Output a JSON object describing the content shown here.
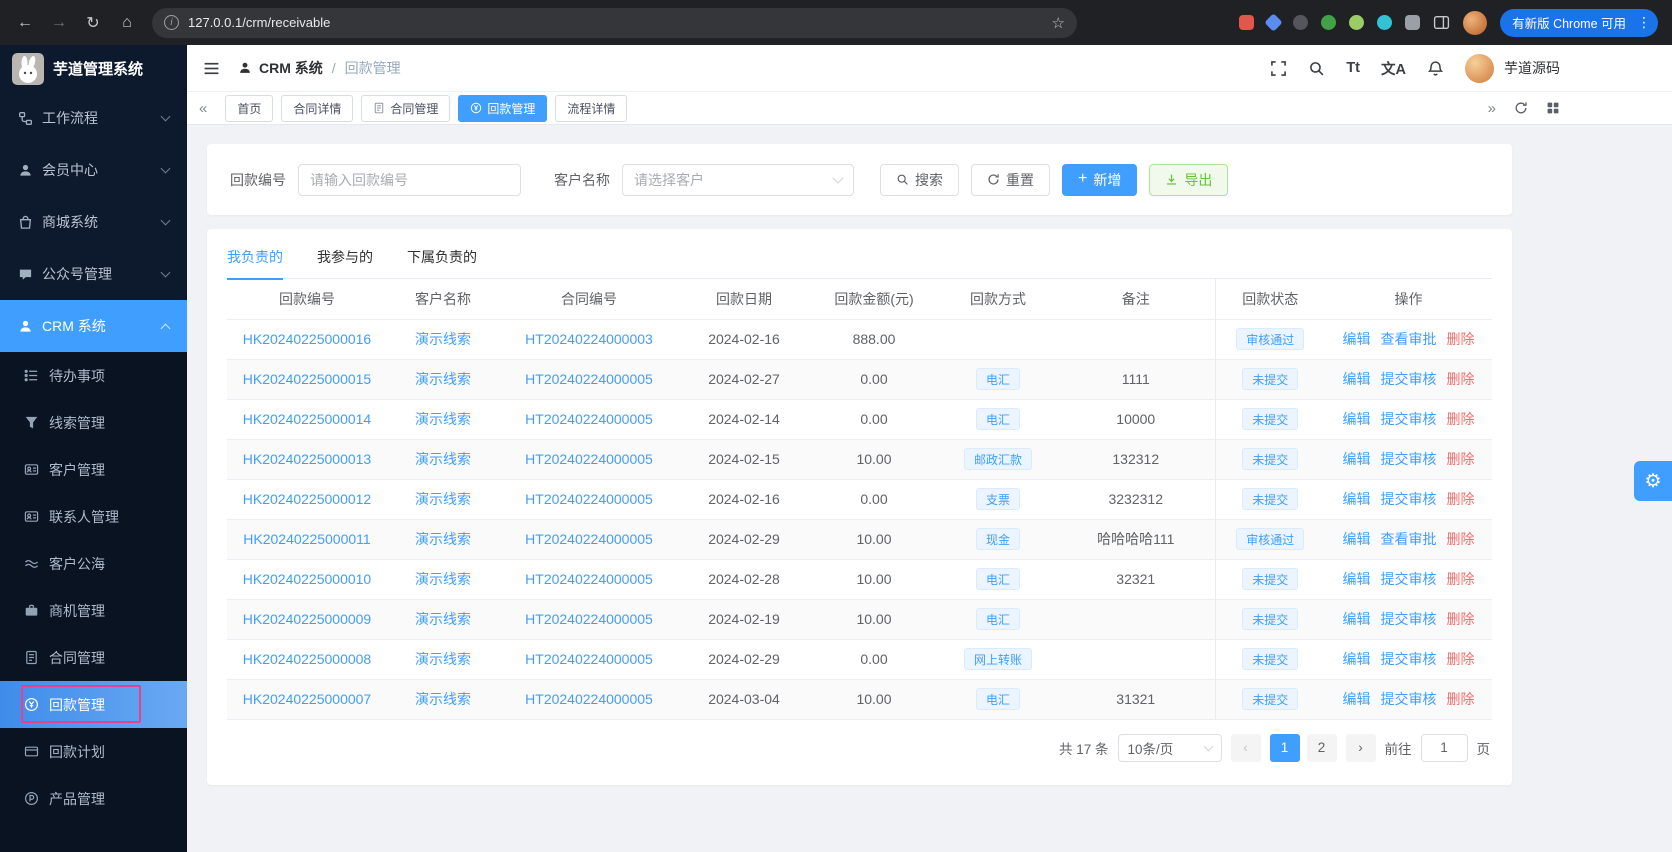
{
  "colors": {
    "primary": "#409eff",
    "danger": "#f56c6c",
    "success": "#67c23a",
    "highlight": "#ea3e8e",
    "chrome_update": "#1a73e8"
  },
  "glyphs": {
    "back": "←",
    "forward": "→",
    "reload": "↻",
    "home": "⌂",
    "star": "☆",
    "info": "i",
    "dots": "⋮",
    "guillemet_left": "«",
    "guillemet_right": "»",
    "prev": "‹",
    "next": "›",
    "plus": "+",
    "gear": "⚙",
    "font_size": "Tt",
    "translate": "文A"
  },
  "browser": {
    "url": "127.0.0.1/crm/receivable",
    "update_button": "有新版 Chrome 可用",
    "extensions": [
      {
        "name": "extension-icon-red",
        "color": "#e2574c",
        "shape": "square"
      },
      {
        "name": "extension-icon-blue",
        "color": "#5b8def",
        "shape": "diamond"
      },
      {
        "name": "extension-icon-dark",
        "color": "#53575d",
        "shape": "circle"
      },
      {
        "name": "extension-icon-green",
        "color": "#43a047",
        "shape": "circle"
      },
      {
        "name": "extension-icon-lightgreen",
        "color": "#9ccc65",
        "shape": "circle"
      },
      {
        "name": "extension-icon-teal",
        "color": "#31c3d4",
        "shape": "circle"
      },
      {
        "name": "extension-icon-puzzle",
        "color": "#9aa0a6",
        "shape": "square"
      }
    ]
  },
  "app": {
    "logo_title": "芋道管理系统",
    "user_name": "芋道源码"
  },
  "sidebar": {
    "top_items": [
      {
        "key": "workflow",
        "label": "工作流程",
        "icon": "flow",
        "active": false
      },
      {
        "key": "member",
        "label": "会员中心",
        "icon": "person",
        "active": false
      },
      {
        "key": "mall",
        "label": "商城系统",
        "icon": "bag",
        "active": false
      },
      {
        "key": "wechat-mp",
        "label": "公众号管理",
        "icon": "chat",
        "active": false
      },
      {
        "key": "crm",
        "label": "CRM 系统",
        "icon": "person",
        "active": true
      }
    ],
    "sub_items": [
      {
        "key": "todo",
        "label": "待办事项",
        "icon": "list",
        "active": false
      },
      {
        "key": "clue",
        "label": "线索管理",
        "icon": "funnel",
        "active": false
      },
      {
        "key": "customer",
        "label": "客户管理",
        "icon": "idcard",
        "active": false
      },
      {
        "key": "contact",
        "label": "联系人管理",
        "icon": "idcard",
        "active": false
      },
      {
        "key": "public-pool",
        "label": "客户公海",
        "icon": "waves",
        "active": false
      },
      {
        "key": "business",
        "label": "商机管理",
        "icon": "briefcase",
        "active": false
      },
      {
        "key": "contract",
        "label": "合同管理",
        "icon": "doc",
        "active": false
      },
      {
        "key": "receivable",
        "label": "回款管理",
        "icon": "money",
        "active": true,
        "highlight": true
      },
      {
        "key": "receivable-plan",
        "label": "回款计划",
        "icon": "card",
        "active": false
      },
      {
        "key": "product",
        "label": "产品管理",
        "icon": "productP",
        "active": false
      }
    ]
  },
  "breadcrumb": {
    "root": "CRM 系统",
    "separator": "/",
    "current": "回款管理"
  },
  "tags_view": [
    {
      "key": "home",
      "label": "首页",
      "icon": null,
      "active": false
    },
    {
      "key": "contract-detail",
      "label": "合同详情",
      "icon": null,
      "active": false
    },
    {
      "key": "contract-manage",
      "label": "合同管理",
      "icon": "doc",
      "active": false
    },
    {
      "key": "receivable-manage",
      "label": "回款管理",
      "icon": "money",
      "active": true
    },
    {
      "key": "process-detail",
      "label": "流程详情",
      "icon": null,
      "active": false
    }
  ],
  "search_form": {
    "number_label": "回款编号",
    "number_placeholder": "请输入回款编号",
    "customer_label": "客户名称",
    "customer_placeholder": "请选择客户",
    "buttons": {
      "search": "搜索",
      "reset": "重置",
      "add": "新增",
      "export": "导出"
    }
  },
  "scene_tabs": [
    {
      "key": "mine",
      "label": "我负责的",
      "active": true
    },
    {
      "key": "joined",
      "label": "我参与的",
      "active": false
    },
    {
      "key": "subordinate",
      "label": "下属负责的",
      "active": false
    }
  ],
  "table": {
    "headers": [
      "回款编号",
      "客户名称",
      "合同编号",
      "回款日期",
      "回款金额(元)",
      "回款方式",
      "备注",
      "回款状态",
      "操作"
    ],
    "rows": [
      {
        "number": "HK20240225000016",
        "customer": "演示线索",
        "contract": "HT20240224000003",
        "date": "2024-02-16",
        "amount": "888.00",
        "method": "",
        "remark": "",
        "status": "审核通过",
        "actions": [
          {
            "key": "edit",
            "label": "编辑"
          },
          {
            "key": "view-approval",
            "label": "查看审批"
          },
          {
            "key": "delete",
            "label": "删除"
          }
        ]
      },
      {
        "number": "HK20240225000015",
        "customer": "演示线索",
        "contract": "HT20240224000005",
        "date": "2024-02-27",
        "amount": "0.00",
        "method": "电汇",
        "remark": "1111",
        "status": "未提交",
        "actions": [
          {
            "key": "edit",
            "label": "编辑"
          },
          {
            "key": "submit-approval",
            "label": "提交审核"
          },
          {
            "key": "delete",
            "label": "删除"
          }
        ]
      },
      {
        "number": "HK20240225000014",
        "customer": "演示线索",
        "contract": "HT20240224000005",
        "date": "2024-02-14",
        "amount": "0.00",
        "method": "电汇",
        "remark": "10000",
        "status": "未提交",
        "actions": [
          {
            "key": "edit",
            "label": "编辑"
          },
          {
            "key": "submit-approval",
            "label": "提交审核"
          },
          {
            "key": "delete",
            "label": "删除"
          }
        ]
      },
      {
        "number": "HK20240225000013",
        "customer": "演示线索",
        "contract": "HT20240224000005",
        "date": "2024-02-15",
        "amount": "10.00",
        "method": "邮政汇款",
        "remark": "132312",
        "status": "未提交",
        "actions": [
          {
            "key": "edit",
            "label": "编辑"
          },
          {
            "key": "submit-approval",
            "label": "提交审核"
          },
          {
            "key": "delete",
            "label": "删除"
          }
        ]
      },
      {
        "number": "HK20240225000012",
        "customer": "演示线索",
        "contract": "HT20240224000005",
        "date": "2024-02-16",
        "amount": "0.00",
        "method": "支票",
        "remark": "3232312",
        "status": "未提交",
        "actions": [
          {
            "key": "edit",
            "label": "编辑"
          },
          {
            "key": "submit-approval",
            "label": "提交审核"
          },
          {
            "key": "delete",
            "label": "删除"
          }
        ]
      },
      {
        "number": "HK20240225000011",
        "customer": "演示线索",
        "contract": "HT20240224000005",
        "date": "2024-02-29",
        "amount": "10.00",
        "method": "现金",
        "remark": "哈哈哈哈111",
        "status": "审核通过",
        "actions": [
          {
            "key": "edit",
            "label": "编辑"
          },
          {
            "key": "view-approval",
            "label": "查看审批"
          },
          {
            "key": "delete",
            "label": "删除"
          }
        ]
      },
      {
        "number": "HK20240225000010",
        "customer": "演示线索",
        "contract": "HT20240224000005",
        "date": "2024-02-28",
        "amount": "10.00",
        "method": "电汇",
        "remark": "32321",
        "status": "未提交",
        "actions": [
          {
            "key": "edit",
            "label": "编辑"
          },
          {
            "key": "submit-approval",
            "label": "提交审核"
          },
          {
            "key": "delete",
            "label": "删除"
          }
        ]
      },
      {
        "number": "HK20240225000009",
        "customer": "演示线索",
        "contract": "HT20240224000005",
        "date": "2024-02-19",
        "amount": "10.00",
        "method": "电汇",
        "remark": "",
        "status": "未提交",
        "actions": [
          {
            "key": "edit",
            "label": "编辑"
          },
          {
            "key": "submit-approval",
            "label": "提交审核"
          },
          {
            "key": "delete",
            "label": "删除"
          }
        ]
      },
      {
        "number": "HK20240225000008",
        "customer": "演示线索",
        "contract": "HT20240224000005",
        "date": "2024-02-29",
        "amount": "0.00",
        "method": "网上转账",
        "remark": "",
        "status": "未提交",
        "actions": [
          {
            "key": "edit",
            "label": "编辑"
          },
          {
            "key": "submit-approval",
            "label": "提交审核"
          },
          {
            "key": "delete",
            "label": "删除"
          }
        ]
      },
      {
        "number": "HK20240225000007",
        "customer": "演示线索",
        "contract": "HT20240224000005",
        "date": "2024-03-04",
        "amount": "10.00",
        "method": "电汇",
        "remark": "31321",
        "status": "未提交",
        "actions": [
          {
            "key": "edit",
            "label": "编辑"
          },
          {
            "key": "submit-approval",
            "label": "提交审核"
          },
          {
            "key": "delete",
            "label": "删除"
          }
        ]
      }
    ]
  },
  "pagination": {
    "total": "共 17 条",
    "page_size": "10条/页",
    "pages": [
      "1",
      "2"
    ],
    "active_page": "1",
    "goto_label": "前往",
    "goto_value": "1",
    "goto_suffix": "页"
  }
}
